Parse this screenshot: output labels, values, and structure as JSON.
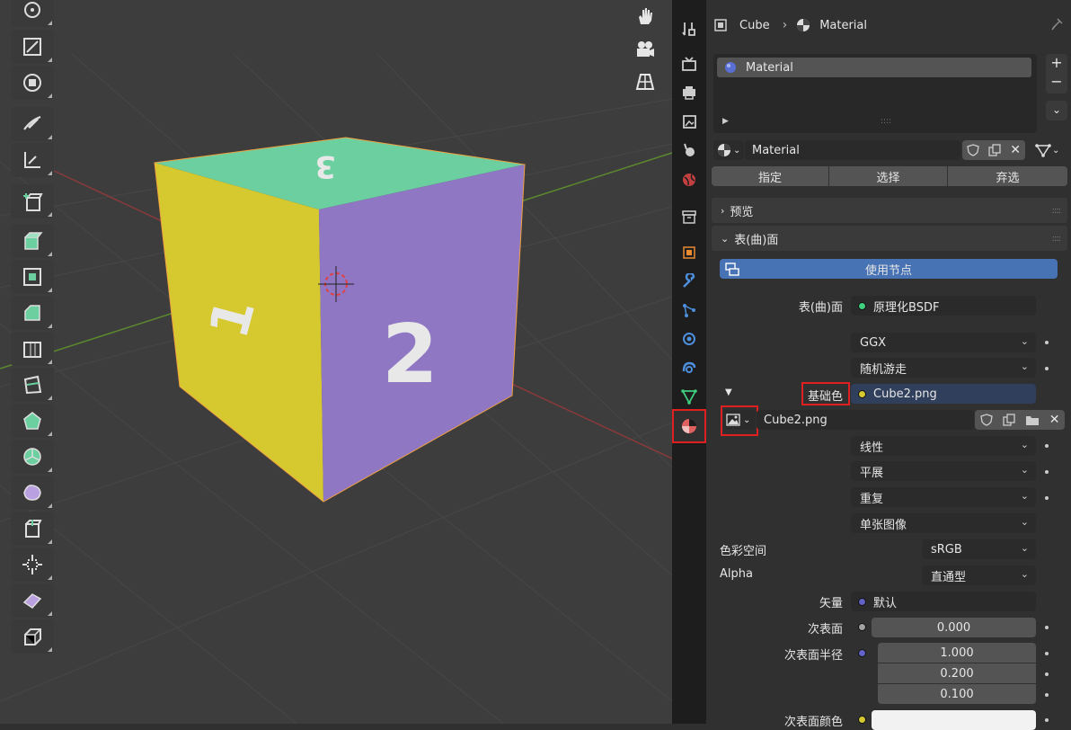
{
  "breadcrumb": {
    "object": "Cube",
    "material": "Material"
  },
  "material_slots": [
    {
      "name": "Material"
    }
  ],
  "datablock": {
    "name": "Material"
  },
  "slot_buttons": {
    "assign": "指定",
    "select": "选择",
    "deselect": "弃选"
  },
  "panels": {
    "preview": "预览",
    "surface": "表(曲)面"
  },
  "use_nodes": "使用节点",
  "surface": {
    "label": "表(曲)面",
    "shader": "原理化BSDF",
    "distribution": "GGX",
    "subsurface_method": "随机游走",
    "base_color_label": "基础色",
    "base_color_value": "Cube2.png",
    "image_name": "Cube2.png",
    "interpolation": "线性",
    "projection": "平展",
    "extension": "重复",
    "source": "单张图像",
    "color_space_label": "色彩空间",
    "color_space": "sRGB",
    "alpha_label": "Alpha",
    "alpha": "直通型",
    "vector_label": "矢量",
    "vector": "默认",
    "subsurface_label": "次表面",
    "subsurface": "0.000",
    "subsurface_radius_label": "次表面半径",
    "subsurface_radius": [
      "1.000",
      "0.200",
      "0.100"
    ],
    "subsurface_color_label": "次表面颜色"
  },
  "cube_faces": {
    "top": "3",
    "left": "1",
    "right": "2"
  },
  "colors": {
    "accent": "#4772b3",
    "highlight": "#e02020",
    "top_face": "#6bcf9f",
    "left_face": "#d6c930",
    "right_face": "#8f77c4"
  }
}
